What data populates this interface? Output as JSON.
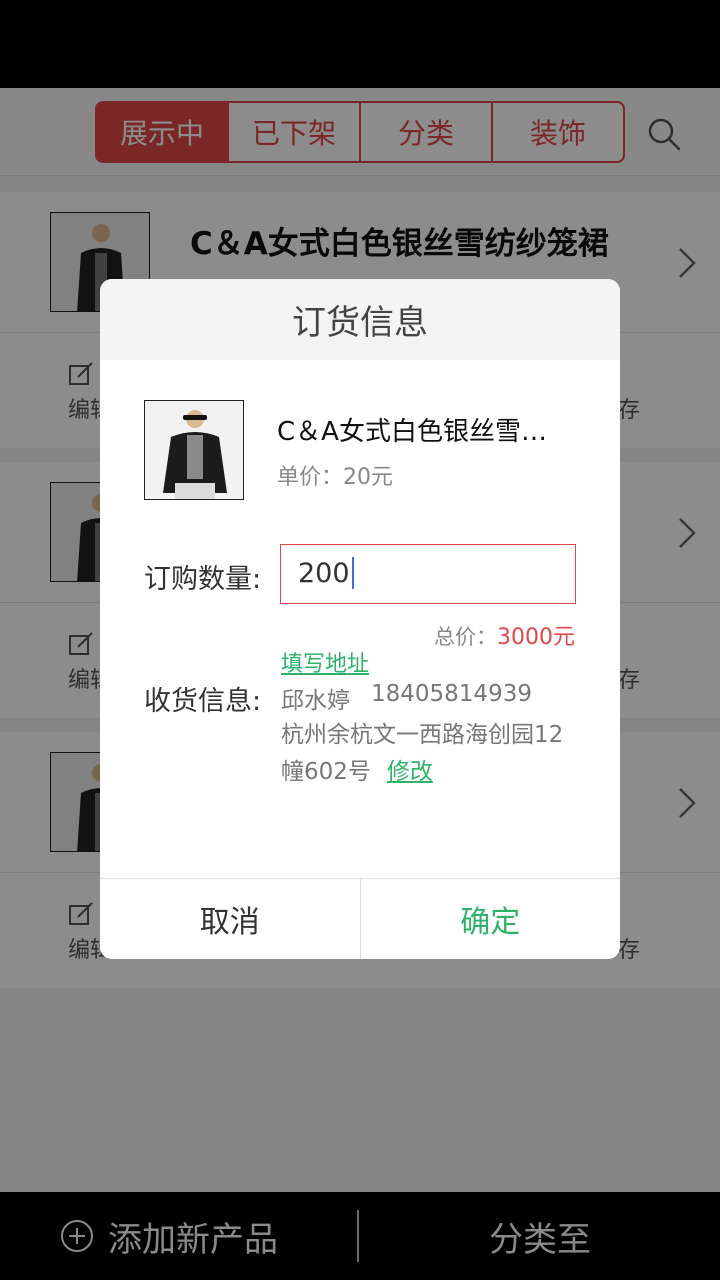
{
  "header": {
    "tabs": [
      {
        "label": "展示中",
        "active": true
      },
      {
        "label": "已下架",
        "active": false
      },
      {
        "label": "分类",
        "active": false
      },
      {
        "label": "装饰",
        "active": false
      }
    ],
    "search_icon": "search-icon"
  },
  "products": [
    {
      "title": "C＆A女式白色银丝雪纺纱笼裙",
      "edit_label": "编辑",
      "stock_label": "库存"
    },
    {
      "title": "",
      "edit_label": "编辑",
      "stock_label": "库存"
    },
    {
      "title": "",
      "edit_label": "编辑",
      "stock_label": "库存"
    }
  ],
  "bottom_bar": {
    "add_label": "添加新产品",
    "category_label": "分类至"
  },
  "dialog": {
    "title": "订货信息",
    "product_name": "C＆A女式白色银丝雪…",
    "unit_price": "单价：20元",
    "qty_label": "订购数量:",
    "qty_value": "200",
    "total_label": "总价：",
    "total_value": "3000元",
    "fill_address_link": "填写地址",
    "shipping_label": "收货信息:",
    "receiver_name": "邱水婷",
    "receiver_phone": "18405814939",
    "receiver_address": "杭州余杭文一西路海创园12幢602号",
    "edit_link": "修改",
    "cancel_label": "取消",
    "confirm_label": "确定"
  },
  "colors": {
    "accent": "#e04848",
    "link_green": "#2fb36a"
  }
}
